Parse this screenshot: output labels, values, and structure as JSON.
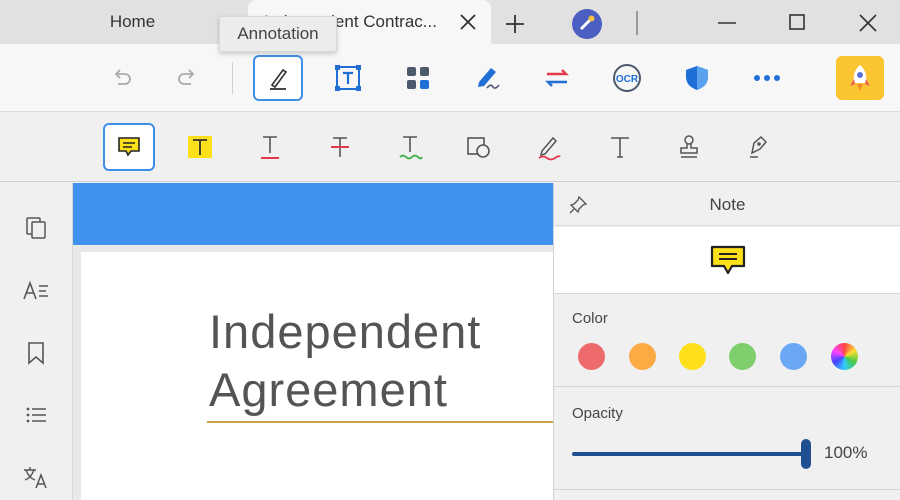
{
  "titlebar": {
    "home_tab": "Home",
    "active_tab": "Independent Contrac...",
    "icons": [
      "close-icon",
      "plus-icon",
      "app-badge-icon",
      "minimize-icon",
      "maximize-icon",
      "close-icon"
    ]
  },
  "tooltip": {
    "text": "Annotation"
  },
  "toolbar": {
    "items": [
      "undo-icon",
      "redo-icon",
      "annotation-icon",
      "edit-text-icon",
      "organize-icon",
      "sign-icon",
      "convert-icon",
      "ocr-icon",
      "protect-icon",
      "more-icon",
      "rocket-icon"
    ],
    "ocr_label": "OCR",
    "active": "annotation-icon"
  },
  "annotation_tools": {
    "items": [
      "note-icon",
      "highlight-icon",
      "underline-icon",
      "strikethrough-icon",
      "squiggly-icon",
      "shape-icon",
      "pencil-icon",
      "text-icon",
      "stamp-icon",
      "signature-icon"
    ],
    "active": "note-icon"
  },
  "sidebar": {
    "items": [
      "pages-icon",
      "text-outline-icon",
      "bookmark-icon",
      "list-icon",
      "translate-icon"
    ]
  },
  "document": {
    "heading_line1": "Independent",
    "heading_line2": "Agreement"
  },
  "panel": {
    "title": "Note",
    "color_label": "Color",
    "opacity_label": "Opacity",
    "opacity_value": "100%",
    "opacity_fraction": 1.0,
    "colors": [
      "#ee6b6b",
      "#fbaa44",
      "#fde01a",
      "#7fce6c",
      "#6aa8f5",
      "rainbow"
    ]
  },
  "colors": {
    "accent": "#3f8fe6",
    "band": "#3f93ee",
    "note_yellow": "#fde01a",
    "rocket": "#fbc531"
  }
}
